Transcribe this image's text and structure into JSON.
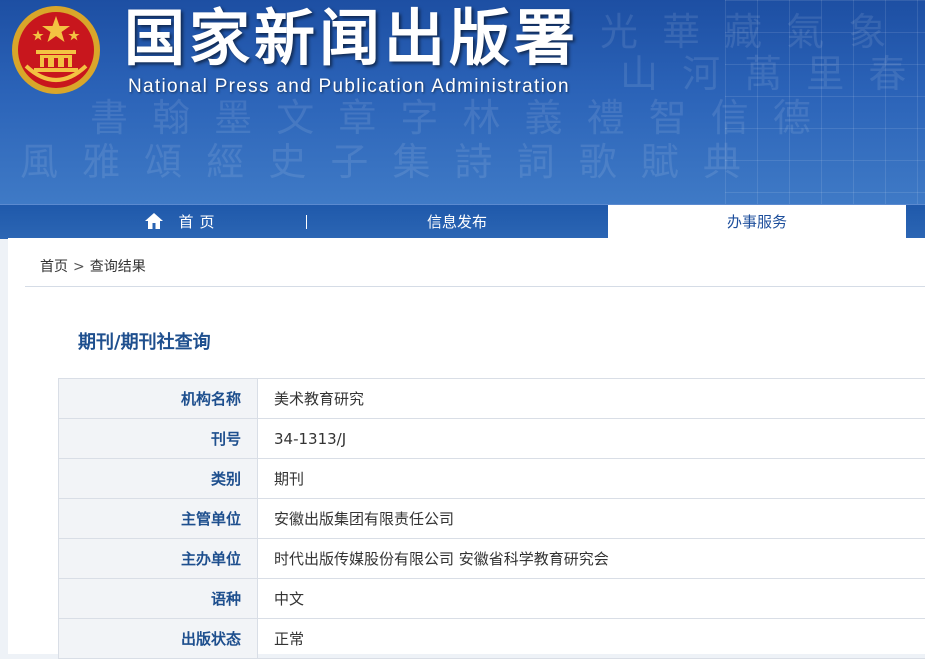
{
  "header": {
    "title": "国家新闻出版署",
    "subtitle": "National  Press and Publication Administration"
  },
  "nav": {
    "home": "首页",
    "items": [
      "信息发布",
      "办事服务"
    ],
    "active": "办事服务"
  },
  "breadcrumb": {
    "home": "首页",
    "separator": ">",
    "current": "查询结果"
  },
  "section_title": "期刊/期刊社查询",
  "table": {
    "rows": [
      {
        "label": "机构名称",
        "value": "美术教育研究"
      },
      {
        "label": "刊号",
        "value": "34-1313/J"
      },
      {
        "label": "类别",
        "value": "期刊"
      },
      {
        "label": "主管单位",
        "value": "安徽出版集团有限责任公司"
      },
      {
        "label": "主办单位",
        "value": "时代出版传媒股份有限公司 安徽省科学教育研究会"
      },
      {
        "label": "语种",
        "value": "中文"
      },
      {
        "label": "出版状态",
        "value": "正常"
      }
    ]
  },
  "colors": {
    "brand_blue": "#2b63b8",
    "title_blue": "#1e4f8e",
    "label_bg": "#f2f4f7"
  },
  "icons": [
    "national-emblem-icon",
    "home-icon"
  ]
}
